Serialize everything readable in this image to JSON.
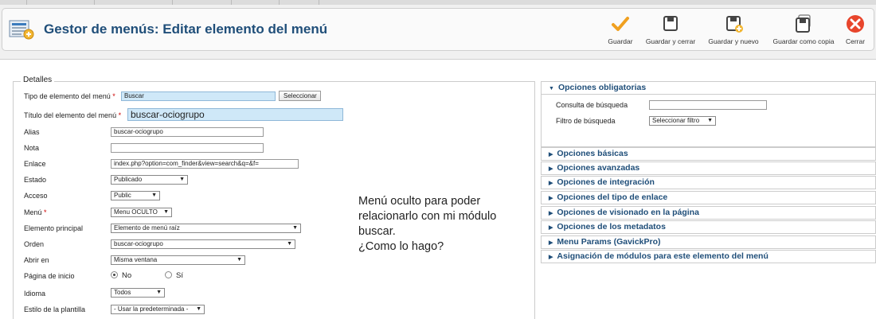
{
  "header": {
    "title": "Gestor de menús: Editar elemento del menú"
  },
  "toolbar": {
    "buttons": [
      {
        "label": "Guardar",
        "icon": "save-check-icon"
      },
      {
        "label": "Guardar y cerrar",
        "icon": "save-close-icon"
      },
      {
        "label": "Guardar y nuevo",
        "icon": "save-new-icon"
      },
      {
        "label": "Guardar como copia",
        "icon": "save-copy-icon"
      },
      {
        "label": "Cerrar",
        "icon": "close-icon"
      }
    ]
  },
  "details": {
    "legend": "Detalles",
    "tipo": {
      "label": "Tipo de elemento del menú",
      "value": "Buscar",
      "button": "Seleccionar"
    },
    "titulo": {
      "label": "Título del elemento del menú",
      "value": "buscar-ociogrupo"
    },
    "alias": {
      "label": "Alias",
      "value": "buscar-ociogrupo"
    },
    "nota": {
      "label": "Nota",
      "value": ""
    },
    "enlace": {
      "label": "Enlace",
      "value": "index.php?option=com_finder&view=search&q=&f="
    },
    "estado": {
      "label": "Estado",
      "value": "Publicado"
    },
    "acceso": {
      "label": "Acceso",
      "value": "Public"
    },
    "menu": {
      "label": "Menú",
      "value": "Menu OCULTO"
    },
    "padre": {
      "label": "Elemento principal",
      "value": "Elemento de menú raíz"
    },
    "orden": {
      "label": "Orden",
      "value": "buscar-ociogrupo"
    },
    "abrir": {
      "label": "Abrir en",
      "value": "Misma ventana"
    },
    "inicio": {
      "label": "Página de inicio",
      "no": "No",
      "si": "Sí",
      "selected": "No"
    },
    "idioma": {
      "label": "Idioma",
      "value": "Todos"
    },
    "estilo": {
      "label": "Estilo de la plantilla",
      "value": "- Usar la predeterminada -"
    }
  },
  "annotation": {
    "lines": [
      "Menú oculto para poder",
      "relacionarlo con mi módulo",
      "buscar.",
      "¿Como lo hago?"
    ]
  },
  "options": {
    "obligatorias": {
      "title": "Opciones obligatorias",
      "consulta": {
        "label": "Consulta de búsqueda",
        "value": ""
      },
      "filtro": {
        "label": "Filtro de búsqueda",
        "value": "Seleccionar filtro"
      }
    },
    "panels": [
      "Opciones básicas",
      "Opciones avanzadas",
      "Opciones de integración",
      "Opciones del tipo de enlace",
      "Opciones de visionado en la página",
      "Opciones de los metadatos",
      "Menu Params (GavickPro)",
      "Asignación de módulos para este elemento del menú"
    ]
  },
  "colors": {
    "title": "#1f4e79",
    "required": "#cc0000",
    "highlight_input": "#cfe8f8"
  }
}
